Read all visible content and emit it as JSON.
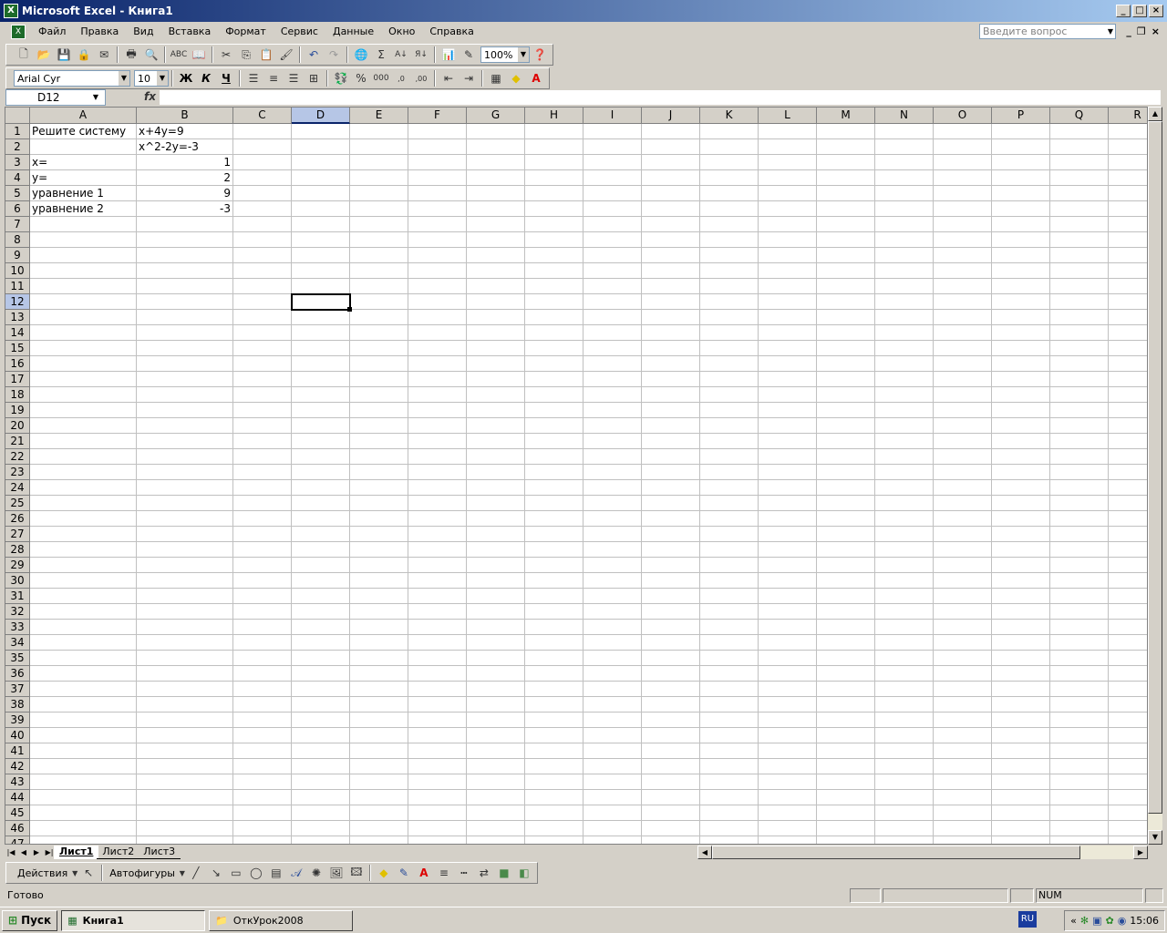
{
  "window": {
    "title": "Microsoft Excel - Книга1"
  },
  "menu": {
    "items": [
      "Файл",
      "Правка",
      "Вид",
      "Вставка",
      "Формат",
      "Сервис",
      "Данные",
      "Окно",
      "Справка"
    ],
    "ask_placeholder": "Введите вопрос"
  },
  "toolbar": {
    "zoom": "100%",
    "font_name": "Arial Cyr",
    "font_size": "10",
    "bold": "Ж",
    "italic": "К",
    "underline": "Ч",
    "percent": "%",
    "thousands": "000"
  },
  "formula_bar": {
    "name_box": "D12",
    "fx_label": "fx",
    "formula": ""
  },
  "grid": {
    "columns": [
      "A",
      "B",
      "C",
      "D",
      "E",
      "F",
      "G",
      "H",
      "I",
      "J",
      "K",
      "L",
      "M",
      "N",
      "O",
      "P",
      "Q",
      "R"
    ],
    "active_column": "D",
    "active_row": 12,
    "row_count": 47,
    "cells": {
      "A1": "Решите систему",
      "B1": "x+4y=9",
      "B2": "x^2-2y=-3",
      "A3": "x=",
      "B3": "1",
      "A4": "y=",
      "B4": "2",
      "A5": "уравнение 1",
      "B5": "9",
      "A6": "уравнение 2",
      "B6": "-3"
    }
  },
  "sheets": {
    "tabs": [
      "Лист1",
      "Лист2",
      "Лист3"
    ],
    "active": "Лист1"
  },
  "drawing": {
    "actions": "Действия",
    "autoshapes": "Автофигуры"
  },
  "status": {
    "ready": "Готово",
    "num": "NUM"
  },
  "taskbar": {
    "start": "Пуск",
    "buttons": [
      "Книга1",
      "ОткУрок2008"
    ],
    "lang": "RU",
    "clock": "15:06"
  }
}
